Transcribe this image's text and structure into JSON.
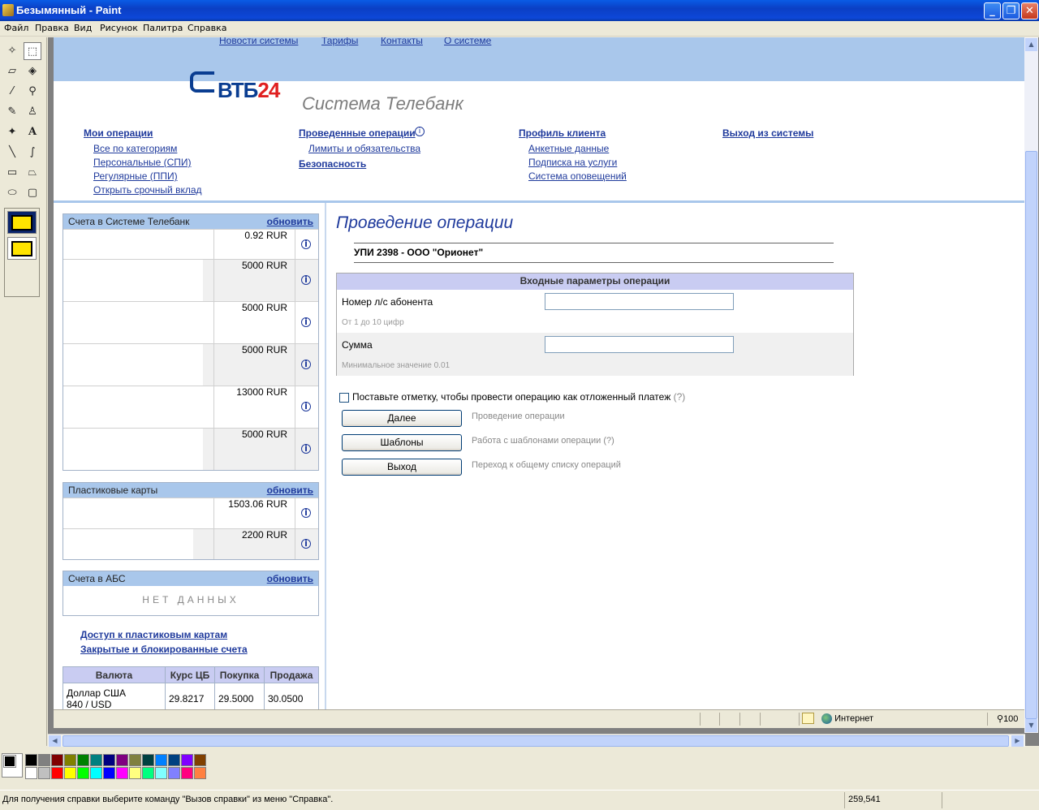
{
  "window": {
    "title": "Безымянный - Paint",
    "min": "_",
    "max": "❐",
    "close": "✕"
  },
  "menu": [
    "Файл",
    "Правка",
    "Вид",
    "Рисунок",
    "Палитра",
    "Справка"
  ],
  "toolbox": {
    "tools": [
      "free-select",
      "rect-select",
      "eraser",
      "fill",
      "color-picker",
      "magnifier",
      "pencil",
      "brush",
      "airbrush",
      "text",
      "line",
      "curve",
      "rectangle",
      "polygon",
      "ellipse",
      "rounded-rectangle"
    ]
  },
  "site": {
    "top_links": [
      "Новости системы",
      "Тарифы",
      "Контакты",
      "О системе"
    ],
    "logo": {
      "text": "ВТБ",
      "num": "24"
    },
    "system_title": "Система Телебанк",
    "nav": {
      "col1": {
        "head": "Мои операции",
        "items": [
          "Все по категориям",
          "Персональные (СПИ)",
          "Регулярные (ППИ)",
          "Открыть срочный вклад"
        ]
      },
      "col2": {
        "head": "Проведенные операции",
        "items": [
          "Лимиты и обязательства"
        ],
        "head2": "Безопасность"
      },
      "col3": {
        "head": "Профиль клиента",
        "items": [
          "Анкетные данные",
          "Подписка на услуги",
          "Система оповещений"
        ]
      },
      "col4": {
        "head": "Выход из системы"
      }
    },
    "accounts": {
      "title": "Счета в Системе Телебанк",
      "refresh": "обновить",
      "rows": [
        {
          "value": "0.92 RUR"
        },
        {
          "value": "5000 RUR"
        },
        {
          "value": "5000 RUR"
        },
        {
          "value": "5000 RUR"
        },
        {
          "value": "13000 RUR"
        },
        {
          "value": "5000 RUR"
        }
      ]
    },
    "cards": {
      "title": "Пластиковые карты",
      "refresh": "обновить",
      "rows": [
        {
          "value": "1503.06 RUR"
        },
        {
          "value": "2200 RUR"
        }
      ]
    },
    "abs": {
      "title": "Счета в АБС",
      "refresh": "обновить",
      "empty": "НЕТ ДАННЫХ"
    },
    "links": [
      "Доступ к пластиковым картам",
      "Закрытые и блокированные счета"
    ],
    "rates": {
      "headers": [
        "Валюта",
        "Курс ЦБ",
        "Покупка",
        "Продажа"
      ],
      "row": {
        "currency_line1": "Доллар США",
        "currency_line2": "840 / USD",
        "cb": "29.8217",
        "buy": "29.5000",
        "sell": "30.0500"
      }
    },
    "main": {
      "title": "Проведение операции",
      "operation": "УПИ 2398 - ООО \"Орионет\"",
      "params_header": "Входные параметры операции",
      "field1": {
        "label": "Номер л/с абонента",
        "hint": "От 1 до 10 цифр",
        "value": ""
      },
      "field2": {
        "label": "Сумма",
        "hint": "Минимальное значение 0.01",
        "value": ""
      },
      "checkbox": "Поставьте отметку, чтобы провести операцию как отложенный платеж",
      "checkbox_help": "(?)",
      "buttons": [
        {
          "label": "Далее",
          "desc": "Проведение операции"
        },
        {
          "label": "Шаблоны",
          "desc": "Работа с шаблонами операции (?)"
        },
        {
          "label": "Выход",
          "desc": "Переход к общему списку операций"
        }
      ]
    },
    "ie_status": {
      "zone": "Интернет",
      "zoom": "100"
    }
  },
  "palette": {
    "colors": [
      "#000000",
      "#808080",
      "#800000",
      "#808000",
      "#008000",
      "#008080",
      "#000080",
      "#800080",
      "#808040",
      "#004040",
      "#0080ff",
      "#004080",
      "#8000ff",
      "#804000",
      "#ffffff",
      "#c0c0c0",
      "#ff0000",
      "#ffff00",
      "#00ff00",
      "#00ffff",
      "#0000ff",
      "#ff00ff",
      "#ffff80",
      "#00ff80",
      "#80ffff",
      "#8080ff",
      "#ff0080",
      "#ff8040"
    ]
  },
  "status": {
    "help": "Для получения справки выберите команду \"Вызов справки\" из меню \"Справка\".",
    "coords": "259,541"
  }
}
